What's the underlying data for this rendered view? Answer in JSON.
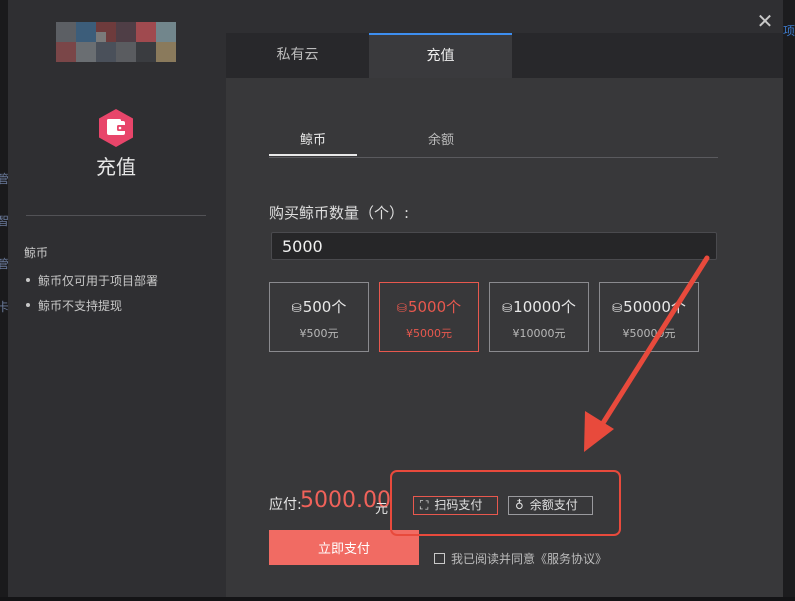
{
  "background": {
    "left_fragments": [
      "管",
      "智",
      "管",
      "卡"
    ],
    "right_fragment": "项"
  },
  "dialog": {
    "close_symbol": "✕",
    "logo_colors": [
      "#5c5f64",
      "#3c5d7a",
      "#6e3b3c",
      "#4f3e46",
      "#a04a4f",
      "#72868c",
      "#7a4648",
      "#6a6e72",
      "#4a505a",
      "#5a5c60",
      "#3a3c40",
      "#8a7a5c",
      "#7a7a7a"
    ]
  },
  "sidebar": {
    "icon": "wallet-icon",
    "icon_color": "#e8456a",
    "title": "充值",
    "section_title": "鲸币",
    "notes": [
      "鲸币仅可用于项目部署",
      "鲸币不支持提现"
    ]
  },
  "tabs": [
    {
      "label": "私有云",
      "active": false
    },
    {
      "label": "充值",
      "active": true
    }
  ],
  "subtabs": [
    {
      "label": "鲸币",
      "active": true
    },
    {
      "label": "余额",
      "active": false
    }
  ],
  "purchase": {
    "label": "购买鲸币数量（个）:",
    "quantity_value": "5000",
    "options": [
      {
        "amount": "500个",
        "price": "¥500元",
        "selected": false
      },
      {
        "amount": "5000个",
        "price": "¥5000元",
        "selected": true
      },
      {
        "amount": "10000个",
        "price": "¥10000元",
        "selected": false
      },
      {
        "amount": "50000个",
        "price": "¥50000元",
        "selected": false
      }
    ]
  },
  "payment": {
    "label": "应付:",
    "amount": "5000.00",
    "unit": "元",
    "methods": [
      {
        "label": "扫码支付",
        "icon": "scan-icon",
        "active": true
      },
      {
        "label": "余额支付",
        "icon": "moneybag-icon",
        "active": false
      }
    ],
    "submit_label": "立即支付",
    "agreement": "我已阅读并同意《服务协议》"
  },
  "colors": {
    "accent": "#f16b63",
    "selected_border": "#e8584e",
    "tab_indicator": "#3d8ef0",
    "annotation": "#e84a3c"
  }
}
